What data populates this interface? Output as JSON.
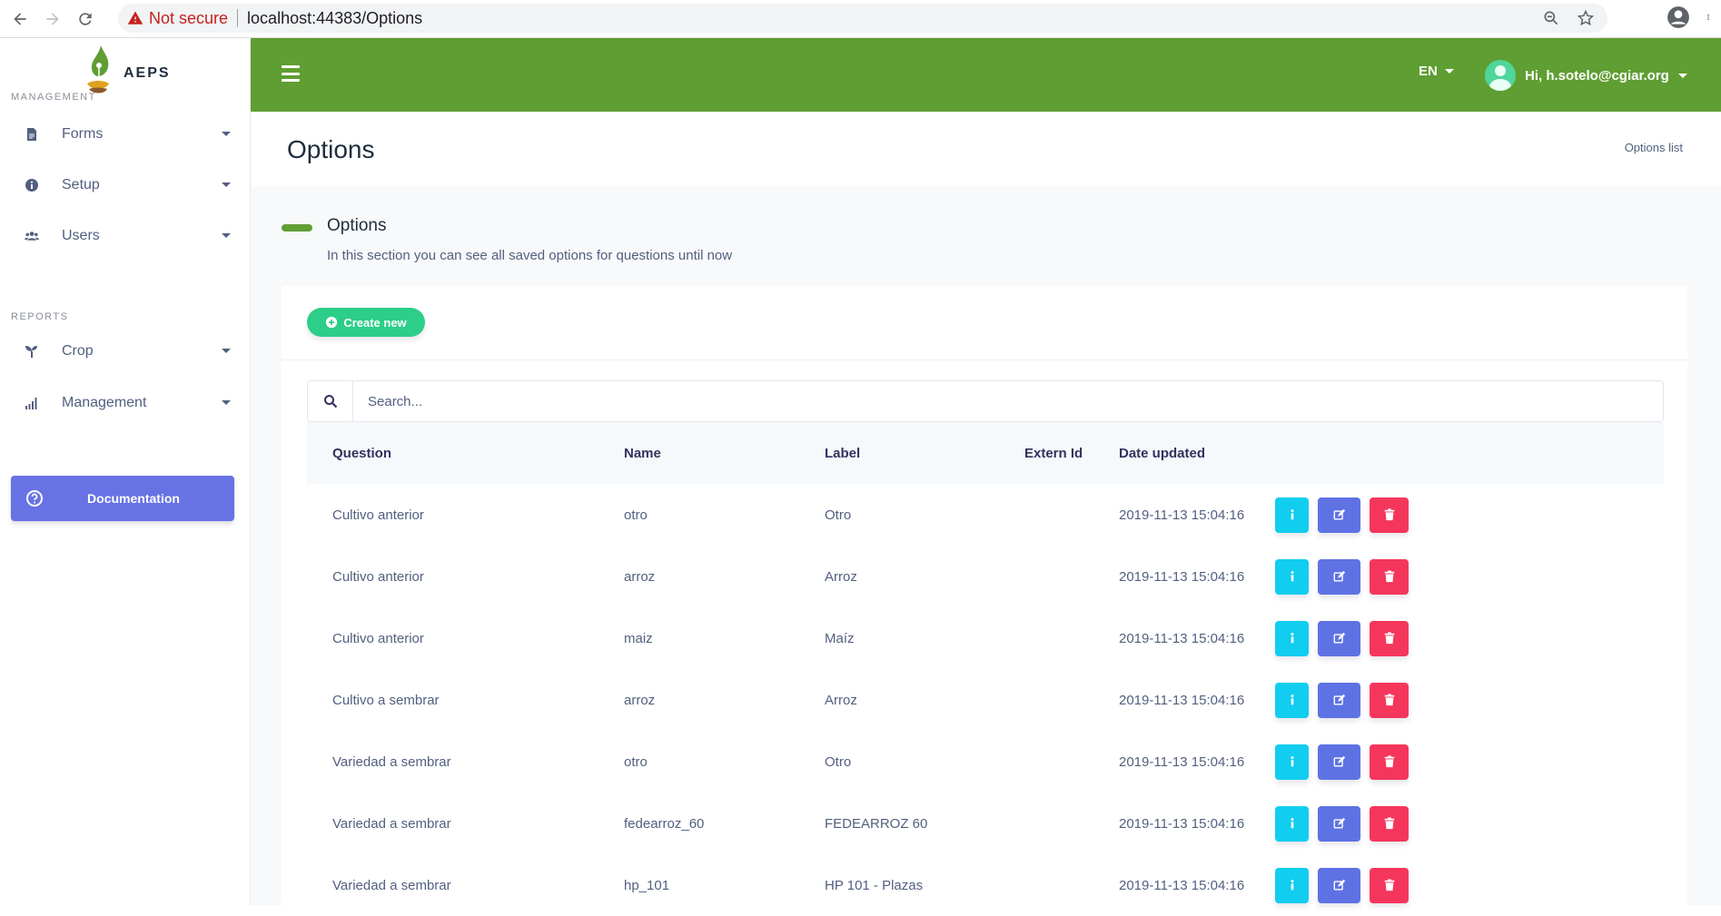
{
  "browser": {
    "security_label": "Not secure",
    "url": "localhost:44383/Options"
  },
  "brand": {
    "name": "AEPS"
  },
  "sidebar": {
    "management_label": "MANAGEMENT",
    "reports_label": "REPORTS",
    "items": [
      {
        "label": "Forms",
        "icon": "file-icon"
      },
      {
        "label": "Setup",
        "icon": "info-circle-icon"
      },
      {
        "label": "Users",
        "icon": "users-icon"
      }
    ],
    "report_items": [
      {
        "label": "Crop",
        "icon": "seedling-icon"
      },
      {
        "label": "Management",
        "icon": "signal-bars-icon"
      }
    ],
    "documentation_label": "Documentation"
  },
  "topbar": {
    "lang": "EN",
    "user": "Hi, h.sotelo@cgiar.org"
  },
  "header": {
    "title": "Options",
    "breadcrumb": "Options list"
  },
  "section": {
    "title": "Options",
    "subtitle": "In this section you can see all saved options for questions until now",
    "create_label": "Create new",
    "search_placeholder": "Search..."
  },
  "table": {
    "columns": [
      "Question",
      "Name",
      "Label",
      "Extern Id",
      "Date updated"
    ],
    "rows": [
      [
        "Cultivo anterior",
        "otro",
        "Otro",
        "",
        "2019-11-13 15:04:16"
      ],
      [
        "Cultivo anterior",
        "arroz",
        "Arroz",
        "",
        "2019-11-13 15:04:16"
      ],
      [
        "Cultivo anterior",
        "maiz",
        "Maíz",
        "",
        "2019-11-13 15:04:16"
      ],
      [
        "Cultivo a sembrar",
        "arroz",
        "Arroz",
        "",
        "2019-11-13 15:04:16"
      ],
      [
        "Variedad a sembrar",
        "otro",
        "Otro",
        "",
        "2019-11-13 15:04:16"
      ],
      [
        "Variedad a sembrar",
        "fedearroz_60",
        "FEDEARROZ 60",
        "",
        "2019-11-13 15:04:16"
      ],
      [
        "Variedad a sembrar",
        "hp_101",
        "HP 101 - Plazas",
        "",
        "2019-11-13 15:04:16"
      ]
    ]
  },
  "colors": {
    "topbar": "#5f9e32",
    "info": "#11cdef",
    "edit": "#5e72e4",
    "delete": "#f5365c",
    "create": "#2dce89",
    "documentation": "#6772e5"
  }
}
